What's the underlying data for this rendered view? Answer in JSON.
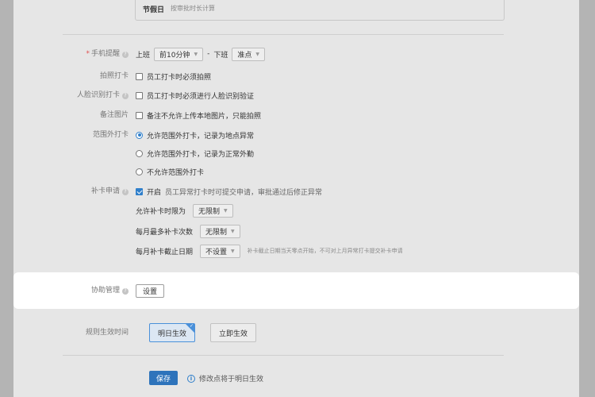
{
  "holiday": {
    "key": "节假日",
    "value": "按审批时长计算"
  },
  "phone_reminder": {
    "label": "手机提醒",
    "on_duty": "上班",
    "on_duty_select": "前10分钟",
    "dash": "-",
    "off_duty": "下班",
    "off_duty_select": "准点"
  },
  "photo_punch": {
    "label": "拍照打卡",
    "option": "员工打卡时必须拍照"
  },
  "face_punch": {
    "label": "人脸识别打卡",
    "option": "员工打卡时必须进行人脸识别验证"
  },
  "remark_photo": {
    "label": "备注图片",
    "option": "备注不允许上传本地图片，只能拍照"
  },
  "out_of_range": {
    "label": "范围外打卡",
    "options": [
      "允许范围外打卡，记录为地点异常",
      "允许范围外打卡，记录为正常外勤",
      "不允许范围外打卡"
    ],
    "selected": 0
  },
  "makeup": {
    "label": "补卡申请",
    "enabled_label": "开启",
    "description": "员工异常打卡时可提交申请，审批通过后修正异常",
    "time_limit_label": "允许补卡时限为",
    "time_limit_value": "无限制",
    "monthly_max_label": "每月最多补卡次数",
    "monthly_max_value": "无限制",
    "deadline_label": "每月补卡截止日期",
    "deadline_value": "不设置",
    "deadline_hint": "补卡截止日期当天零点开始，不可对上月异常打卡提交补卡申请"
  },
  "assist": {
    "label": "协助管理",
    "button": "设置"
  },
  "effective": {
    "label": "规则生效时间",
    "tomorrow": "明日生效",
    "now": "立即生效"
  },
  "footer": {
    "save": "保存",
    "info": "修改点将于明日生效"
  },
  "colors": {
    "accent": "#2f7fcb",
    "primary_button": "#2e73bb",
    "required": "#e05050"
  }
}
